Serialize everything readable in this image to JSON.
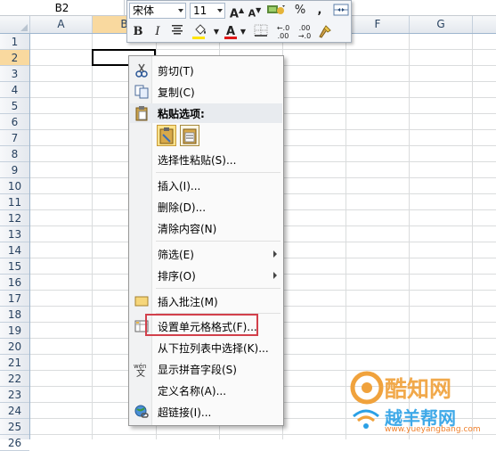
{
  "name_box": "B2",
  "columns": [
    "A",
    "B",
    "C",
    "D",
    "E",
    "F",
    "G"
  ],
  "rows": [
    "1",
    "2",
    "3",
    "4",
    "5",
    "6",
    "7",
    "8",
    "9",
    "10",
    "11",
    "12",
    "13",
    "14",
    "15",
    "16",
    "17",
    "18",
    "19",
    "20",
    "21",
    "22",
    "23",
    "24",
    "25",
    "26"
  ],
  "mini_toolbar": {
    "font_name": "宋体",
    "font_size": "11",
    "grow_font": "A",
    "shrink_font": "A",
    "percent": "%",
    "comma": ",",
    "bold": "B",
    "italic": "I",
    "font_color": "A",
    "increase_decimal": ".00",
    "decrease_decimal": ".0"
  },
  "context_menu": {
    "cut": "剪切(T)",
    "copy": "复制(C)",
    "paste_options": "粘贴选项:",
    "paste_special": "选择性粘贴(S)...",
    "insert": "插入(I)...",
    "delete": "删除(D)...",
    "clear": "清除内容(N)",
    "filter": "筛选(E)",
    "sort": "排序(O)",
    "insert_comment": "插入批注(M)",
    "format_cells": "设置单元格格式(F)...",
    "pick_list": "从下拉列表中选择(K)...",
    "phonetic": "显示拼音字段(S)",
    "define_name": "定义名称(A)...",
    "hyperlink": "超链接(I)..."
  },
  "watermark": {
    "brand": "酷知网",
    "brand2": "越羊帮网",
    "url": "www.yueyangbang.com"
  },
  "colors": {
    "highlight_box": "#d2404b",
    "selected_header": "#f9d99f",
    "font_color_bar": "#e01818",
    "fill_color_bar": "#ffe400"
  }
}
